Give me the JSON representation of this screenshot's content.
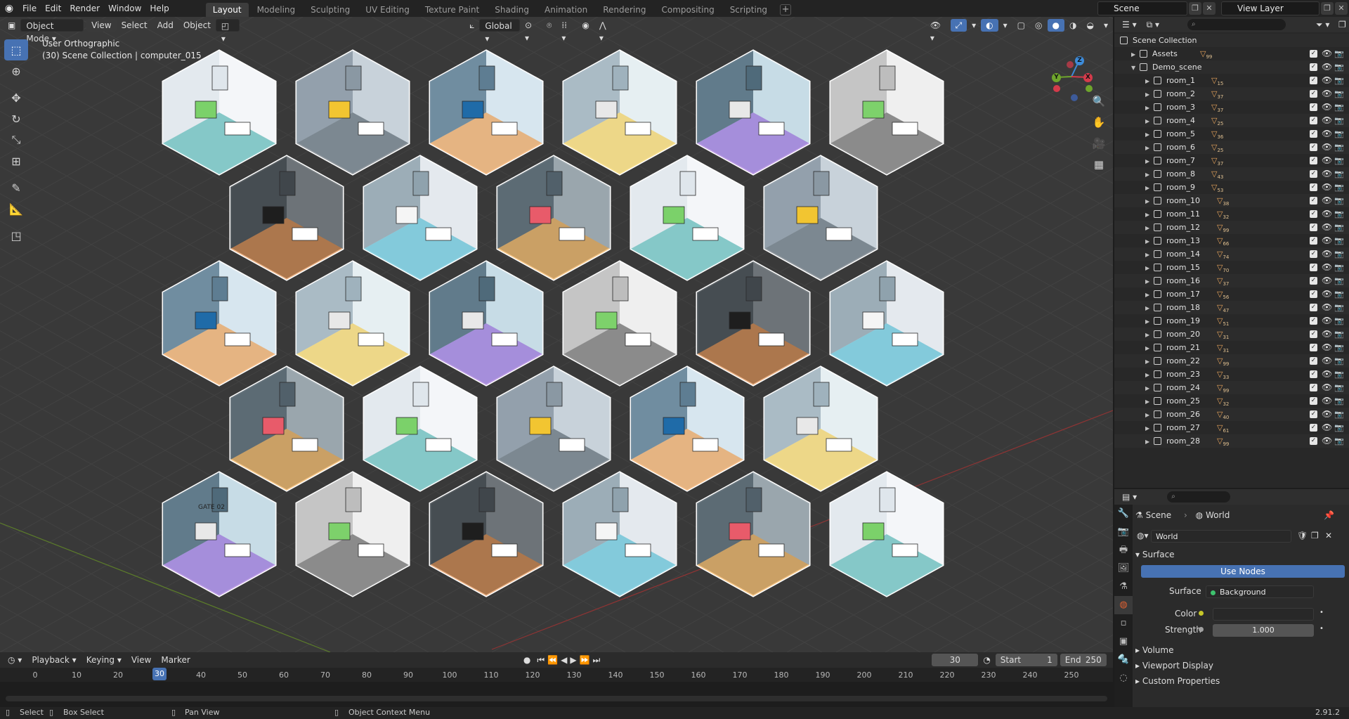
{
  "topbar": {
    "menus": [
      "File",
      "Edit",
      "Render",
      "Window",
      "Help"
    ],
    "workspaces": [
      "Layout",
      "Modeling",
      "Sculpting",
      "UV Editing",
      "Texture Paint",
      "Shading",
      "Animation",
      "Rendering",
      "Compositing",
      "Scripting"
    ],
    "active_workspace": "Layout",
    "scene": "Scene",
    "view_layer": "View Layer"
  },
  "viewport": {
    "mode": "Object Mode",
    "menus": [
      "View",
      "Select",
      "Add",
      "Object"
    ],
    "transform_orientation": "Global",
    "view_name": "User Orthographic",
    "collection_info": "(30) Scene Collection | computer_015",
    "gizmo_axes": {
      "x": "X",
      "y": "Y",
      "z": "Z"
    },
    "room_signage": "GATE 02"
  },
  "timeline": {
    "menus": [
      "Playback",
      "Keying",
      "View",
      "Marker"
    ],
    "current_frame": "30",
    "start_label": "Start",
    "start": "1",
    "end_label": "End",
    "end": "250",
    "ticks": [
      "0",
      "10",
      "20",
      "30",
      "40",
      "50",
      "60",
      "70",
      "80",
      "90",
      "100",
      "110",
      "120",
      "130",
      "140",
      "150",
      "160",
      "170",
      "180",
      "190",
      "200",
      "210",
      "220",
      "230",
      "240",
      "250"
    ]
  },
  "statusbar": {
    "select": "Select",
    "box_select": "Box Select",
    "pan_view": "Pan View",
    "context_menu": "Object Context Menu",
    "version": "2.91.2"
  },
  "outliner": {
    "root": "Scene Collection",
    "assets": "Assets",
    "assets_count": "99",
    "demo": "Demo_scene",
    "rooms": [
      {
        "name": "room_1",
        "count": "15"
      },
      {
        "name": "room_2",
        "count": "37"
      },
      {
        "name": "room_3",
        "count": "37"
      },
      {
        "name": "room_4",
        "count": "25"
      },
      {
        "name": "room_5",
        "count": "36"
      },
      {
        "name": "room_6",
        "count": "25"
      },
      {
        "name": "room_7",
        "count": "37"
      },
      {
        "name": "room_8",
        "count": "43"
      },
      {
        "name": "room_9",
        "count": "53"
      },
      {
        "name": "room_10",
        "count": "38"
      },
      {
        "name": "room_11",
        "count": "32"
      },
      {
        "name": "room_12",
        "count": "99"
      },
      {
        "name": "room_13",
        "count": "66"
      },
      {
        "name": "room_14",
        "count": "74"
      },
      {
        "name": "room_15",
        "count": "70"
      },
      {
        "name": "room_16",
        "count": "37"
      },
      {
        "name": "room_17",
        "count": "56"
      },
      {
        "name": "room_18",
        "count": "47"
      },
      {
        "name": "room_19",
        "count": "51"
      },
      {
        "name": "room_20",
        "count": "31"
      },
      {
        "name": "room_21",
        "count": "31"
      },
      {
        "name": "room_22",
        "count": "99"
      },
      {
        "name": "room_23",
        "count": "33"
      },
      {
        "name": "room_24",
        "count": "99"
      },
      {
        "name": "room_25",
        "count": "32"
      },
      {
        "name": "room_26",
        "count": "40"
      },
      {
        "name": "room_27",
        "count": "61"
      },
      {
        "name": "room_28",
        "count": "99"
      }
    ]
  },
  "properties": {
    "breadcrumb_scene": "Scene",
    "breadcrumb_world": "World",
    "world_name": "World",
    "surface_panel": "Surface",
    "use_nodes": "Use Nodes",
    "surface_label": "Surface",
    "surface_value": "Background",
    "color_label": "Color",
    "strength_label": "Strength",
    "strength_value": "1.000",
    "volume_panel": "Volume",
    "viewport_display_panel": "Viewport Display",
    "custom_props_panel": "Custom Properties"
  }
}
